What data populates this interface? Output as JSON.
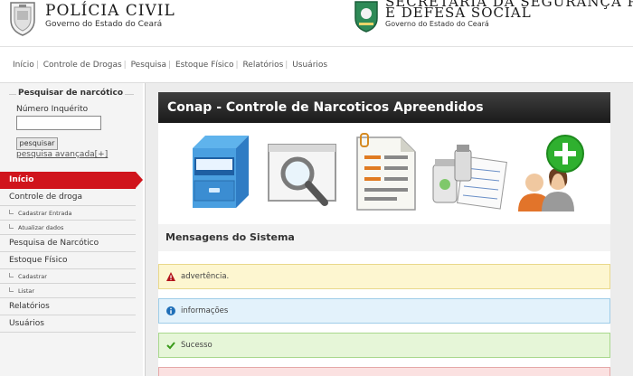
{
  "header": {
    "brand_title": "POLÍCIA CIVIL",
    "brand_subtitle": "Governo do Estado do Ceará",
    "secretaria_line1": "SECRETARIA DA SEGURANÇA PÚBLICA",
    "secretaria_line2": "E DEFESA SOCIAL",
    "secretaria_subtitle": "Governo do Estado do Ceará"
  },
  "nav": {
    "items": [
      "Início",
      "Controle de Drogas",
      "Pesquisa",
      "Estoque Físico",
      "Relatórios",
      "Usuários"
    ]
  },
  "search": {
    "legend": "Pesquisar de narcótico",
    "label": "Número Inquérito",
    "value": "",
    "button": "pesquisar",
    "advanced": "pesquisa avançada[+]"
  },
  "menu": {
    "inicio": "Início",
    "controle": "Controle de droga",
    "cadastrar_entrada": "Cadastrar Entrada",
    "atualizar_dados": "Atualizar dados",
    "pesquisa": "Pesquisa de Narcótico",
    "estoque": "Estoque Físico",
    "cadastrar": "Cadastrar",
    "listar": "Listar",
    "relatorios": "Relatórios",
    "usuarios": "Usuários"
  },
  "main": {
    "title": "Conap - Controle de Narcoticos Apreendidos",
    "messages_header": "Mensagens do Sistema",
    "icons": [
      "file-cabinet-icon",
      "search-magnifier-icon",
      "report-document-icon",
      "pharmacy-chart-icon",
      "add-users-icon"
    ],
    "alerts": {
      "warning": "advertência.",
      "info": "informações",
      "success": "Sucesso",
      "error": ""
    }
  },
  "colors": {
    "accent_red": "#d0141c",
    "title_bar": "#2a2a2a",
    "warning_bg": "#fdf6d0",
    "info_bg": "#e3f2fb",
    "success_bg": "#e6f6d8",
    "error_bg": "#fbe1e1"
  }
}
